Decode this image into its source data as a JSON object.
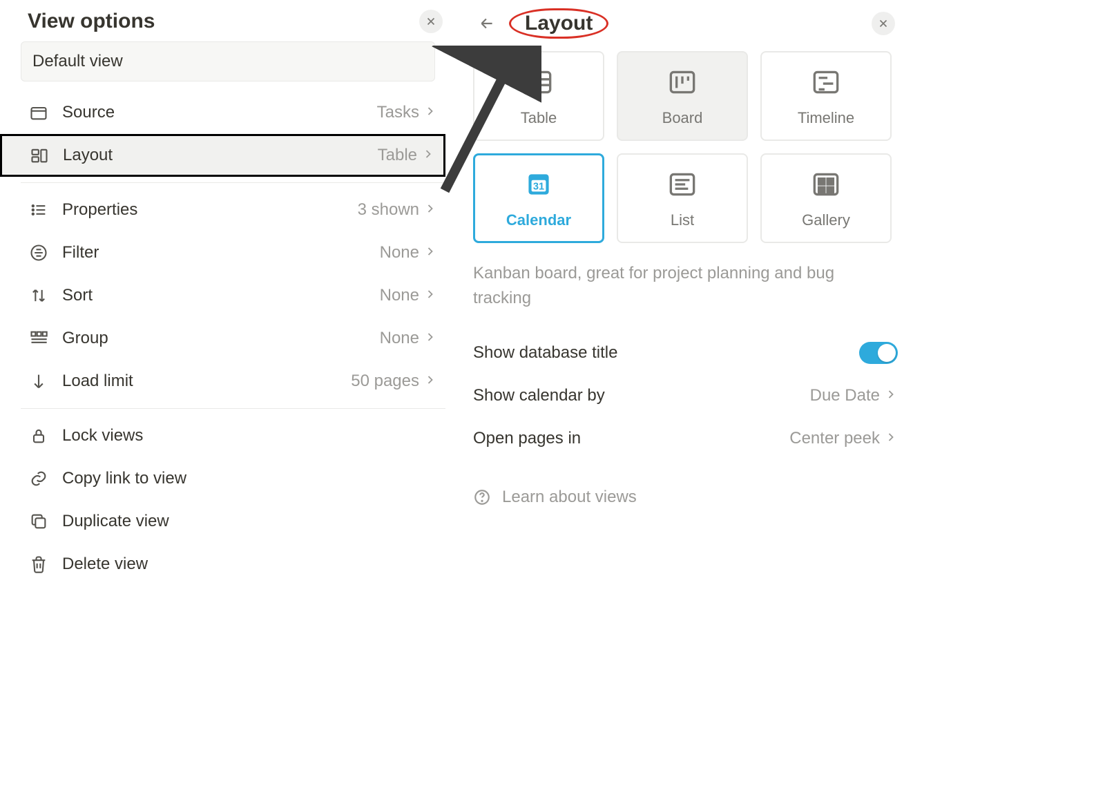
{
  "left": {
    "title": "View options",
    "view_name": "Default view",
    "items": {
      "source": {
        "label": "Source",
        "value": "Tasks"
      },
      "layout": {
        "label": "Layout",
        "value": "Table"
      },
      "properties": {
        "label": "Properties",
        "value": "3 shown"
      },
      "filter": {
        "label": "Filter",
        "value": "None"
      },
      "sort": {
        "label": "Sort",
        "value": "None"
      },
      "group": {
        "label": "Group",
        "value": "None"
      },
      "loadlimit": {
        "label": "Load limit",
        "value": "50 pages"
      }
    },
    "actions": {
      "lock": "Lock views",
      "copylink": "Copy link to view",
      "duplicate": "Duplicate view",
      "delete": "Delete view"
    }
  },
  "right": {
    "title": "Layout",
    "tiles": {
      "table": "Table",
      "board": "Board",
      "timeline": "Timeline",
      "calendar": "Calendar",
      "list": "List",
      "gallery": "Gallery"
    },
    "description": "Kanban board, great for project planning and bug tracking",
    "settings": {
      "show_db_title": {
        "label": "Show database title",
        "value": true
      },
      "show_cal_by": {
        "label": "Show calendar by",
        "value": "Due Date"
      },
      "open_pages": {
        "label": "Open pages in",
        "value": "Center peek"
      }
    },
    "learn": "Learn about views"
  },
  "colors": {
    "accent": "#2eaadc",
    "highlight_border": "#000000",
    "annotate_red": "#d93025"
  }
}
